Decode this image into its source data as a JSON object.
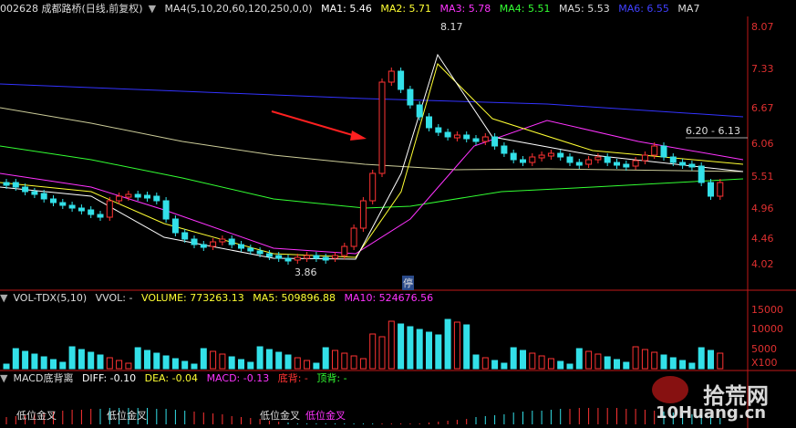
{
  "header": {
    "code_name": "002628 成都路桥(日线,前复权)",
    "ma_title": "MA4(5,10,20,60,120,250,0,0)",
    "ma1": "MA1: 5.46",
    "ma2": "MA2: 5.71",
    "ma3": "MA3: 5.78",
    "ma4": "MA4: 5.51",
    "ma5": "MA5: 5.53",
    "ma6": "MA6: 6.55",
    "ma7": "MA7"
  },
  "price_axis": [
    "8.07",
    "7.33",
    "6.67",
    "6.06",
    "5.51",
    "4.96",
    "4.46",
    "4.02"
  ],
  "annotations": {
    "high": "8.17",
    "low": "3.86",
    "range": "6.20 - 6.13",
    "halt": "停"
  },
  "volume_header": {
    "name": "VOL-TDX(5,10)",
    "vvol": "VVOL: -",
    "volume": "VOLUME: 773263.13",
    "ma5": "MA5: 509896.88",
    "ma10": "MA10: 524676.56"
  },
  "volume_axis": [
    "15000",
    "10000",
    "5000",
    "X100"
  ],
  "macd_header": {
    "name": "MACD底背离",
    "diff": "DIFF: -0.10",
    "dea": "DEA: -0.04",
    "macd": "MACD: -0.13",
    "bottom": "底背: -",
    "top": "顶背: -"
  },
  "macd_labels": [
    "低位金叉",
    "低位金叉",
    "低位金叉",
    "低位金叉"
  ],
  "watermark": {
    "brand": "拾荒网",
    "domain": "10Huang.cn"
  },
  "colors": {
    "up": "#ff3333",
    "down": "#33e0e8",
    "ma1": "#ffffff",
    "ma2": "#ffff33",
    "ma3": "#ff33ff",
    "ma4": "#33ff33",
    "ma6": "#3333ff",
    "axis": "#c01818"
  }
}
